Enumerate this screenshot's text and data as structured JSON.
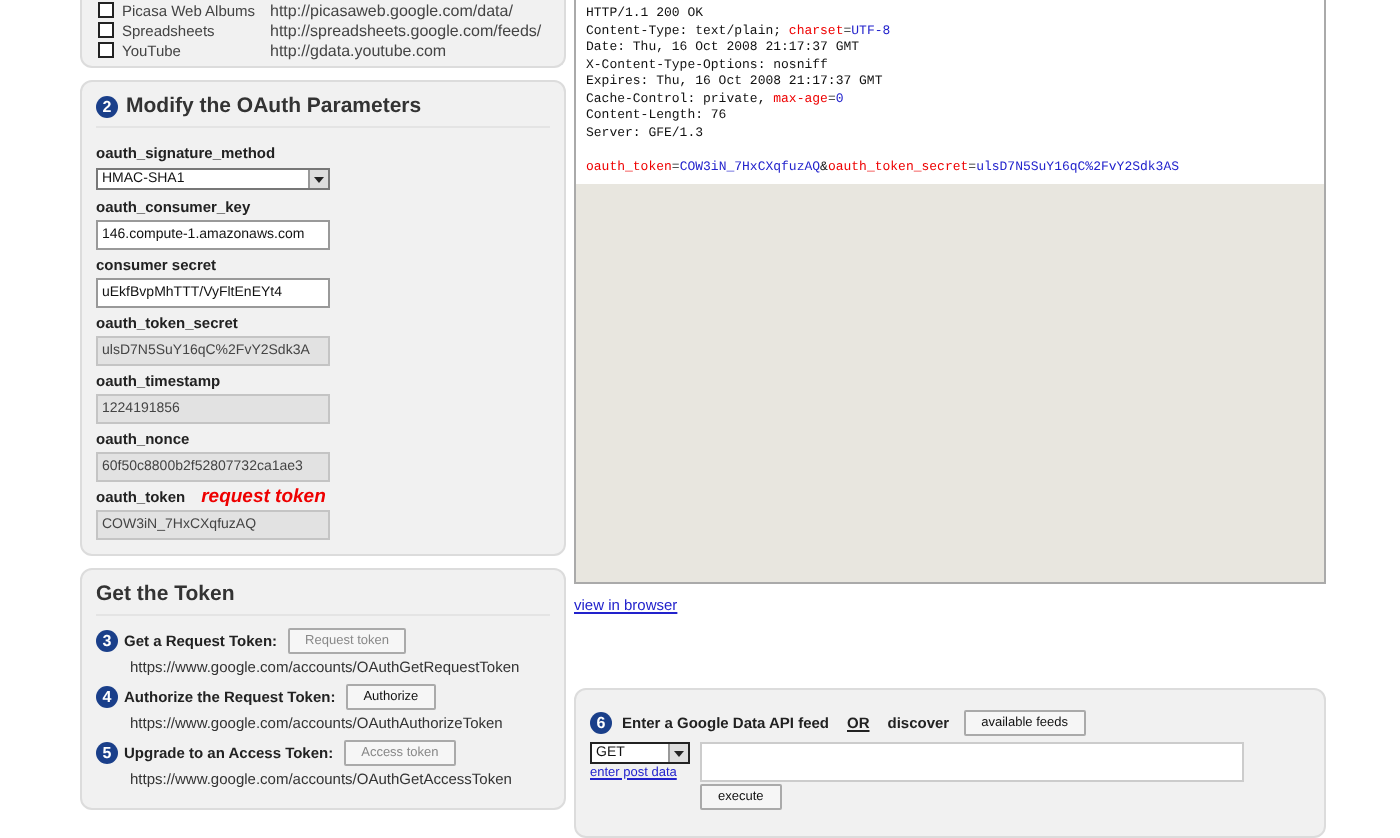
{
  "feeds": [
    {
      "name": "Picasa Web Albums",
      "url": "http://picasaweb.google.com/data/",
      "checked": false
    },
    {
      "name": "Spreadsheets",
      "url": "http://spreadsheets.google.com/feeds/",
      "checked": false
    },
    {
      "name": "YouTube",
      "url": "http://gdata.youtube.com",
      "checked": false
    }
  ],
  "params": {
    "step": "2",
    "title": "Modify the OAuth Parameters",
    "fields": [
      {
        "label": "oauth_signature_method",
        "kind": "select",
        "value": "HMAC-SHA1"
      },
      {
        "label": "oauth_consumer_key",
        "kind": "input",
        "value": "146.compute-1.amazonaws.com",
        "disabled": false
      },
      {
        "label": "consumer secret",
        "kind": "input",
        "value": "uEkfBvpMhTTT/VyFltEnEYt4",
        "disabled": false
      },
      {
        "label": "oauth_token_secret",
        "kind": "input",
        "value": "ulsD7N5SuY16qC%2FvY2Sdk3A",
        "disabled": true
      },
      {
        "label": "oauth_timestamp",
        "kind": "input",
        "value": "1224191856",
        "disabled": true
      },
      {
        "label": "oauth_nonce",
        "kind": "input",
        "value": "60f50c8800b2f52807732ca1ae3",
        "disabled": true
      },
      {
        "label": "oauth_token",
        "note": "request token",
        "kind": "input",
        "value": "COW3iN_7HxCXqfuzAQ",
        "disabled": true
      }
    ]
  },
  "token": {
    "title": "Get the Token",
    "steps": [
      {
        "step": "3",
        "label": "Get a Request Token:",
        "button": "Request token",
        "disabled": true,
        "url": "https://www.google.com/accounts/OAuthGetRequestToken"
      },
      {
        "step": "4",
        "label": "Authorize the Request Token:",
        "button": "Authorize",
        "disabled": false,
        "url": "https://www.google.com/accounts/OAuthAuthorizeToken"
      },
      {
        "step": "5",
        "label": "Upgrade to an Access Token:",
        "button": "Access token",
        "disabled": true,
        "url": "https://www.google.com/accounts/OAuthGetAccessToken"
      }
    ]
  },
  "response": {
    "lines": [
      {
        "kind": "text",
        "parts": [
          {
            "text": "HTTP/1.1 200 OK",
            "kind": "plain"
          }
        ]
      },
      {
        "kind": "text",
        "parts": [
          {
            "text": "Content-Type: text/plain; ",
            "kind": "plain"
          },
          {
            "text": "charset",
            "kind": "key"
          },
          {
            "text": "=",
            "kind": "plain"
          },
          {
            "text": "UTF-8",
            "kind": "value"
          }
        ]
      },
      {
        "kind": "text",
        "parts": [
          {
            "text": "Date: Thu, 16 Oct 2008 21:17:37 GMT",
            "kind": "plain"
          }
        ]
      },
      {
        "kind": "text",
        "parts": [
          {
            "text": "X-Content-Type-Options: nosniff",
            "kind": "plain"
          }
        ]
      },
      {
        "kind": "text",
        "parts": [
          {
            "text": "Expires: Thu, 16 Oct 2008 21:17:37 GMT",
            "kind": "plain"
          }
        ]
      },
      {
        "kind": "text",
        "parts": [
          {
            "text": "Cache-Control: private, ",
            "kind": "plain"
          },
          {
            "text": "max-age",
            "kind": "key"
          },
          {
            "text": "=",
            "kind": "plain"
          },
          {
            "text": "0",
            "kind": "value"
          }
        ]
      },
      {
        "kind": "text",
        "parts": [
          {
            "text": "Content-Length: 76",
            "kind": "plain"
          }
        ]
      },
      {
        "kind": "text",
        "parts": [
          {
            "text": "Server: GFE/1.3",
            "kind": "plain"
          }
        ]
      },
      {
        "kind": "blank"
      },
      {
        "kind": "text",
        "parts": [
          {
            "text": "oauth_token",
            "kind": "key"
          },
          {
            "text": "=",
            "kind": "plain"
          },
          {
            "text": "COW3iN_7HxCXqfuzAQ",
            "kind": "value"
          },
          {
            "text": "&",
            "kind": "plain"
          },
          {
            "text": "oauth_token_secret",
            "kind": "key"
          },
          {
            "text": "=",
            "kind": "plain"
          },
          {
            "text": "ulsD7N5SuY16qC%2FvY2Sdk3AS",
            "kind": "value"
          }
        ]
      }
    ]
  },
  "view_link": "view in browser",
  "query": {
    "step": "6",
    "text": "Enter a Google Data API feed",
    "or": "OR",
    "discover": "discover",
    "button": "available feeds",
    "method": "GET",
    "post_link": "enter post data",
    "execute": "execute"
  }
}
